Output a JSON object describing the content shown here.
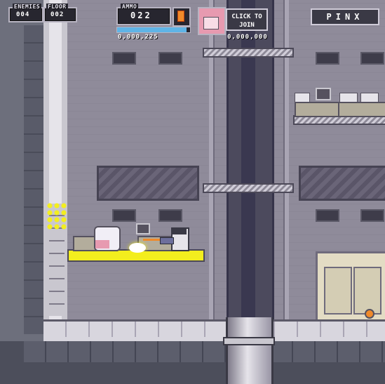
{
  "hud": {
    "enemies_label": "ENEMIES",
    "enemies_value": "004",
    "floor_label": "FLOOR",
    "floor_value": "002",
    "ammo_label": "AMMO",
    "ammo_value": "022",
    "ammo_fill_fraction": 0.95,
    "score_value": "0,000,225",
    "join_label": "CLICK TO JOIN",
    "join_score": "0,000,000",
    "brand": "PINX"
  },
  "colors": {
    "wall": "#8e8a98",
    "floor": "#c9c7cf",
    "ammo_bar": "#5fb4e6",
    "hud_bg": "#27262f",
    "explosion": "#f3ee1e",
    "player2_portrait": "#e79ab0"
  }
}
